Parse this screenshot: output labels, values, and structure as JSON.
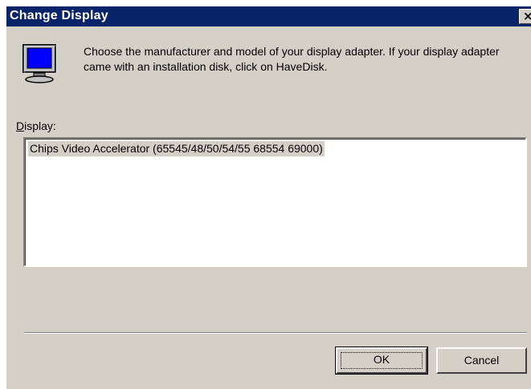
{
  "window": {
    "title": "Change Display",
    "close_glyph": "×"
  },
  "header": {
    "icon": "monitor-icon",
    "instructions": "Choose the manufacturer and model of your display adapter.  If your display adapter came with an installation disk, click on HaveDisk."
  },
  "display": {
    "label_mnemonic": "D",
    "label_rest": "isplay:",
    "items": [
      "Chips Video Accelerator (65545/48/50/54/55 68554 69000)"
    ],
    "selected_index": 0
  },
  "buttons": {
    "ok": "OK",
    "cancel": "Cancel"
  },
  "colors": {
    "title_bar": "#0a246a",
    "face": "#d4d0c8",
    "selection": "#d4d0c8"
  }
}
